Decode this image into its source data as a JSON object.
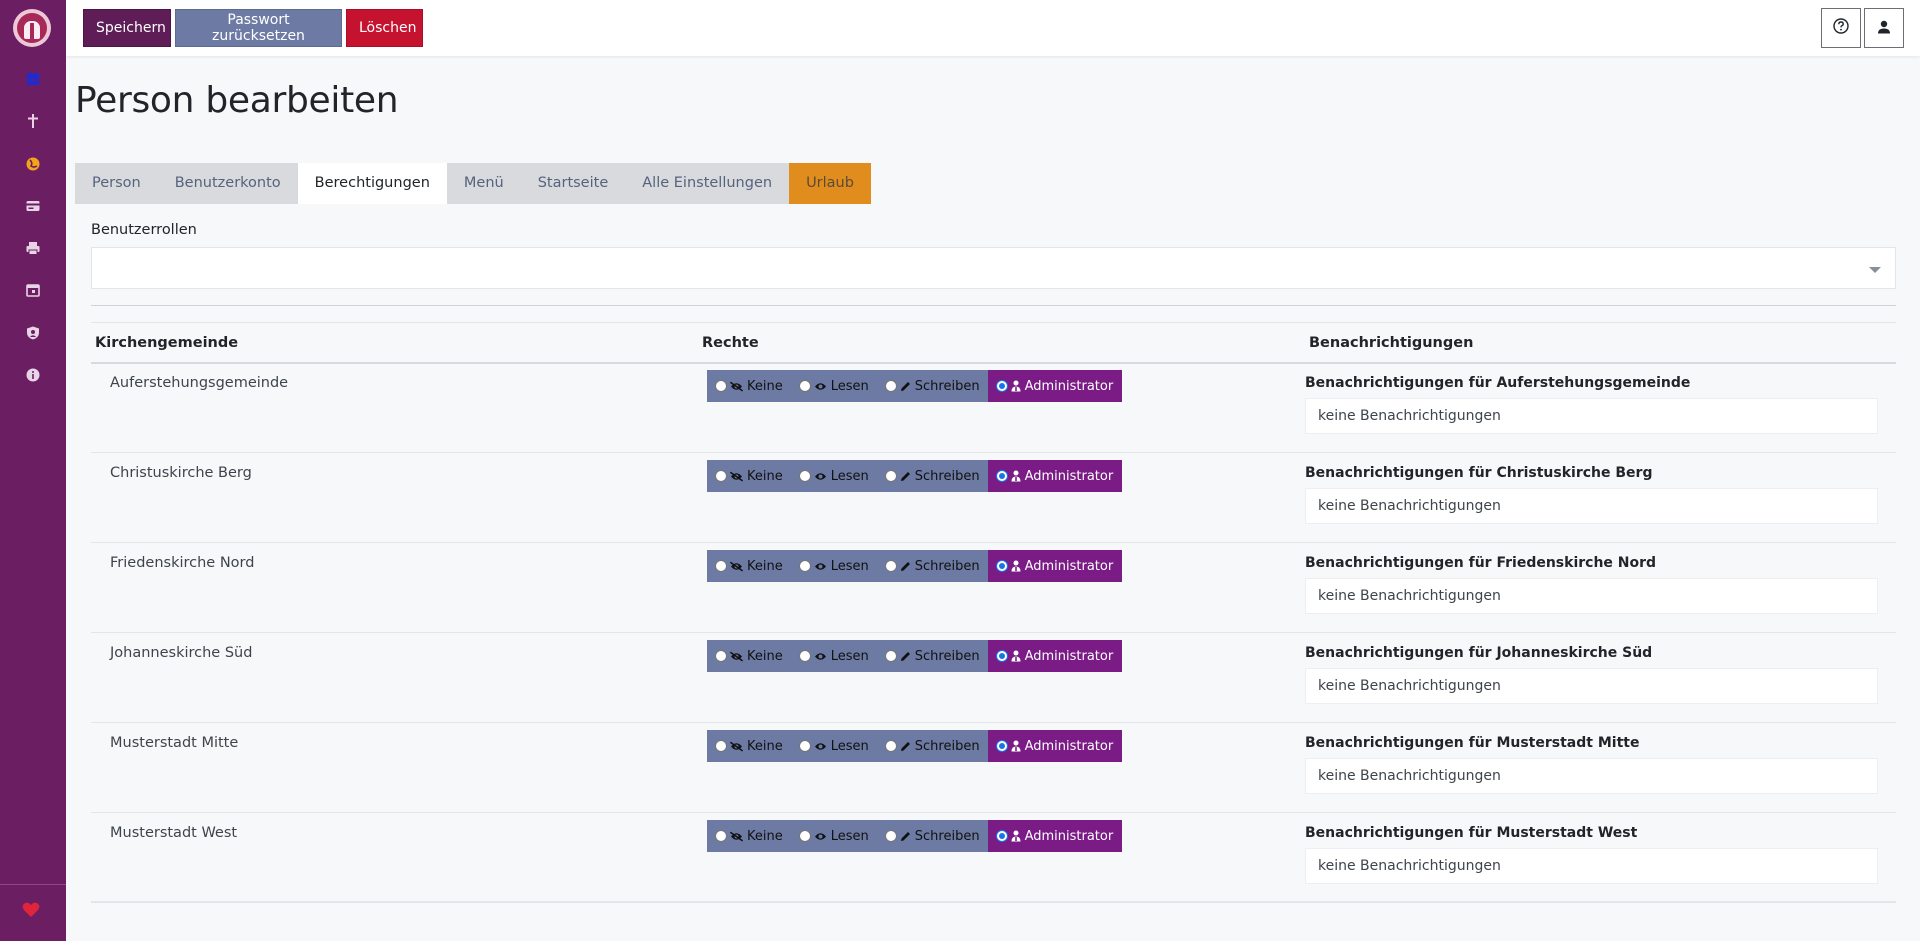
{
  "toolbar": {
    "save_label": "Speichern",
    "reset_password_label": "Passwort zurücksetzen",
    "delete_label": "Löschen",
    "help_icon": "help-circle-icon",
    "user_icon": "user-icon"
  },
  "sidebar": {
    "items": [
      {
        "icon": "calendar-icon"
      },
      {
        "icon": "cross-icon"
      },
      {
        "icon": "globe-icon"
      },
      {
        "icon": "card-icon"
      },
      {
        "icon": "printer-icon"
      },
      {
        "icon": "calendar-day-icon"
      },
      {
        "icon": "shield-user-icon"
      },
      {
        "icon": "info-icon"
      }
    ],
    "footer_icon": "heart-icon"
  },
  "page": {
    "title": "Person bearbeiten"
  },
  "tabs": [
    {
      "label": "Person"
    },
    {
      "label": "Benutzerkonto"
    },
    {
      "label": "Berechtigungen",
      "active": true
    },
    {
      "label": "Menü"
    },
    {
      "label": "Startseite"
    },
    {
      "label": "Alle Einstellungen"
    },
    {
      "label": "Urlaub",
      "accent": "#e08d1d"
    }
  ],
  "roles": {
    "label": "Benutzerrollen",
    "value": ""
  },
  "table": {
    "headers": {
      "parish": "Kirchengemeinde",
      "rights": "Rechte",
      "notifications": "Benachrichtigungen"
    },
    "permission_options": [
      "Keine",
      "Lesen",
      "Schreiben",
      "Administrator"
    ],
    "rows": [
      {
        "parish": "Auferstehungsgemeinde",
        "selected": "Administrator",
        "notif_label": "Benachrichtigungen für Auferstehungsgemeinde",
        "notif_value": "keine Benachrichtigungen"
      },
      {
        "parish": "Christuskirche Berg",
        "selected": "Administrator",
        "notif_label": "Benachrichtigungen für Christuskirche Berg",
        "notif_value": "keine Benachrichtigungen"
      },
      {
        "parish": "Friedenskirche Nord",
        "selected": "Administrator",
        "notif_label": "Benachrichtigungen für Friedenskirche Nord",
        "notif_value": "keine Benachrichtigungen"
      },
      {
        "parish": "Johanneskirche Süd",
        "selected": "Administrator",
        "notif_label": "Benachrichtigungen für Johanneskirche Süd",
        "notif_value": "keine Benachrichtigungen"
      },
      {
        "parish": "Musterstadt Mitte",
        "selected": "Administrator",
        "notif_label": "Benachrichtigungen für Musterstadt Mitte",
        "notif_value": "keine Benachrichtigungen"
      },
      {
        "parish": "Musterstadt West",
        "selected": "Administrator",
        "notif_label": "Benachrichtigungen für Musterstadt West",
        "notif_value": "keine Benachrichtigungen"
      }
    ]
  },
  "colors": {
    "sidebar": "#6b1f62",
    "primary": "#5e1d57",
    "secondary": "#6d7ba4",
    "danger": "#c5122f",
    "admin": "#7b1c86",
    "vacation_tab": "#e08d1d"
  }
}
